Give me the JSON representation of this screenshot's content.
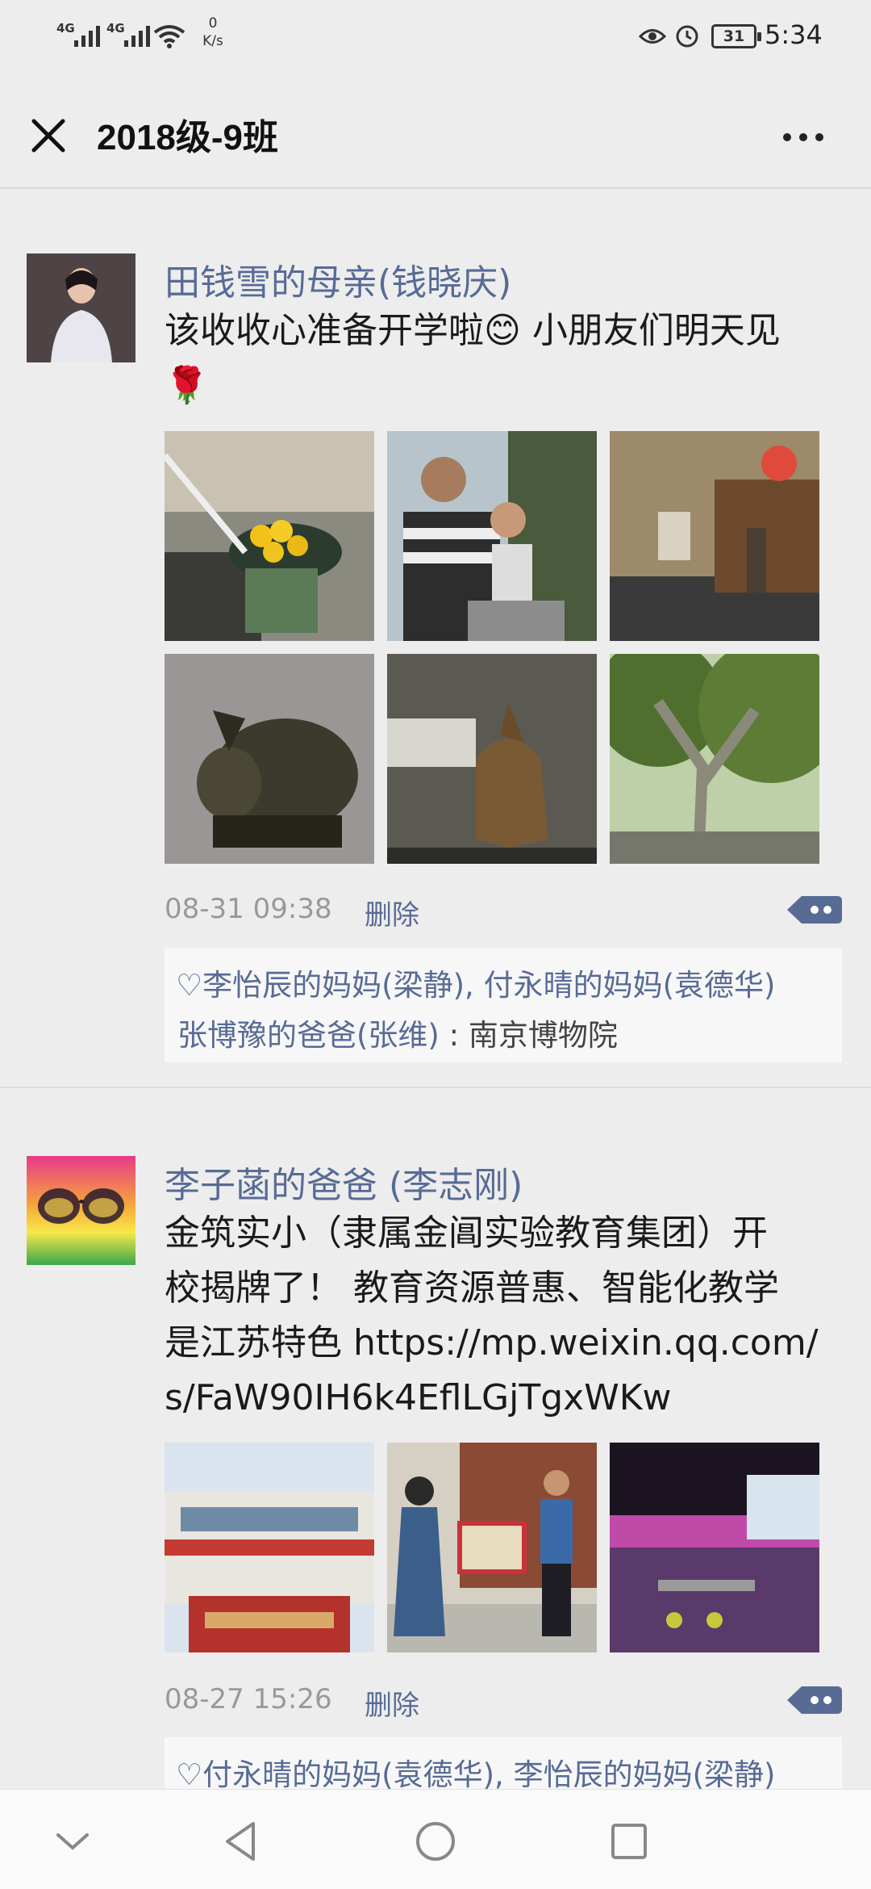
{
  "status_bar": {
    "signal_1": "4G",
    "signal_2": "4G",
    "speed_value": "0",
    "speed_unit": "K/s",
    "battery": "31",
    "time": "5:34"
  },
  "header": {
    "title": "2018级-9班",
    "close_icon": "close-icon",
    "more_icon": "more-icon"
  },
  "posts": [
    {
      "author": "田钱雪的母亲(钱晓庆)",
      "text_line1": "该收收心准备开学啦😊 小朋友们明天见",
      "text_line2": "🌹",
      "time": "08-31 09:38",
      "delete_label": "删除",
      "likes": "李怡辰的妈妈(梁静), 付永晴的妈妈(袁德华)",
      "comment_author": "张博豫的爸爸(张维)",
      "comment_text": " : 南京博物院"
    },
    {
      "author": "李子菡的爸爸 (李志刚)",
      "text_line1": "金筑实小（隶属金阊实验教育集团）开",
      "text_line2": "校揭牌了！ 教育资源普惠、智能化教学",
      "text_line3": "是江苏特色 https://mp.weixin.qq.com/",
      "text_line4": "s/FaW90IH6k4EflLGjTgxWKw",
      "time": "08-27 15:26",
      "delete_label": "删除",
      "likes": "付永晴的妈妈(袁德华), 李怡辰的妈妈(梁静)"
    }
  ],
  "icons": {
    "like": "heart-icon",
    "action": "comment-action-icon",
    "nav_back": "chevron-down-icon",
    "nav_triangle": "back-triangle-icon",
    "nav_home": "home-circle-icon",
    "nav_recent": "recents-square-icon"
  },
  "colors": {
    "link": "#576b95",
    "background": "#ededed"
  }
}
